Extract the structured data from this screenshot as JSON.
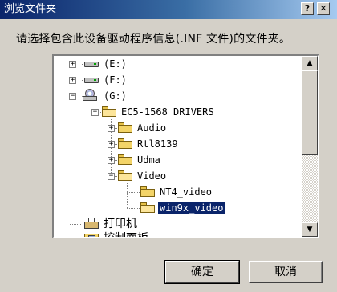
{
  "window": {
    "title": "浏览文件夹",
    "help_label": "?",
    "close_label": "✕"
  },
  "instruction": "请选择包含此设备驱动程序信息(.INF 文件)的文件夹。",
  "tree": {
    "drive_e": "(E:)",
    "drive_f": "(F:)",
    "drive_g": "(G:)",
    "ec5": "EC5-1568 DRIVERS",
    "audio": "Audio",
    "rtl": "Rtl8139",
    "udma": "Udma",
    "video": "Video",
    "nt4": "NT4_video",
    "win9x": "win9x_video",
    "printer": "打印机",
    "control_panel": "控制面板",
    "selected": "win9x_video"
  },
  "scrollbar": {
    "up_arrow": "▲",
    "down_arrow": "▼"
  },
  "buttons": {
    "ok": "确定",
    "cancel": "取消"
  }
}
